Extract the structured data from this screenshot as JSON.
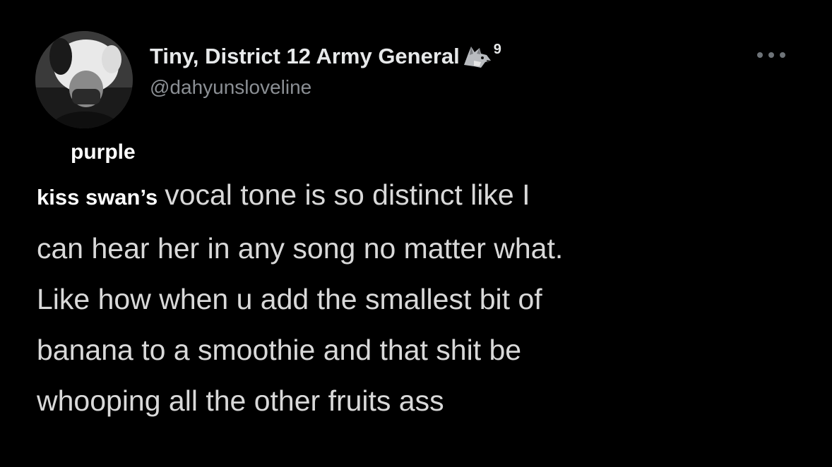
{
  "tweet": {
    "display_name": "Tiny, District 12 Army General",
    "badge_icon": "wolf-icon",
    "badge_count": "9",
    "handle": "@dahyunsloveline",
    "more_icon": "more-options-icon",
    "overlay": {
      "line1": "purple",
      "line2": "kiss swan’s"
    },
    "body_lines": [
      "vocal tone is so distinct like I",
      "can hear her in any song no matter what.",
      "Like how when u add the smallest bit of",
      "banana to a smoothie and that shit be",
      "whooping all the other fruits ass"
    ]
  },
  "colors": {
    "background": "#000000",
    "name": "#e7e9ea",
    "handle": "#8b8f94",
    "body": "#d9d9d9",
    "overlay": "#ffffff"
  }
}
